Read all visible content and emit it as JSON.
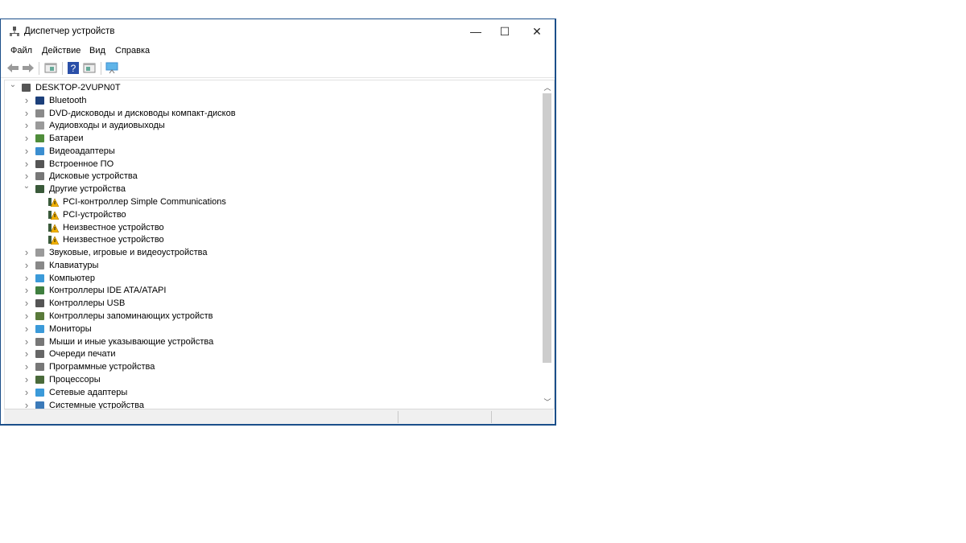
{
  "window": {
    "title": "Диспетчер устройств",
    "minimize": "—",
    "maximize": "☐",
    "close": "✕"
  },
  "menu": [
    "Файл",
    "Действие",
    "Вид",
    "Справка"
  ],
  "toolbar": [
    "back-icon",
    "forward-icon",
    "properties-pane-icon",
    "help-icon",
    "update-driver-icon",
    "monitor-scan-icon"
  ],
  "tree": {
    "root": "DESKTOP-2VUPN0T",
    "items": [
      {
        "label": "Bluetooth",
        "icon": "bluetooth-icon",
        "color": "#1c3f7a",
        "expanded": false
      },
      {
        "label": "DVD-дисководы и дисководы компакт-дисков",
        "icon": "dvd-drive-icon",
        "color": "#8a8a8a",
        "expanded": false
      },
      {
        "label": "Аудиовходы и аудиовыходы",
        "icon": "speaker-icon",
        "color": "#9a9a9a",
        "expanded": false
      },
      {
        "label": "Батареи",
        "icon": "battery-icon",
        "color": "#4f8d3a",
        "expanded": false
      },
      {
        "label": "Видеоадаптеры",
        "icon": "display-adapter-icon",
        "color": "#3b8ed0",
        "expanded": false
      },
      {
        "label": "Встроенное ПО",
        "icon": "firmware-icon",
        "color": "#555555",
        "expanded": false
      },
      {
        "label": "Дисковые устройства",
        "icon": "disk-drive-icon",
        "color": "#777777",
        "expanded": false
      },
      {
        "label": "Другие устройства",
        "icon": "other-devices-icon",
        "color": "#3a5a3a",
        "expanded": true,
        "children": [
          "PCI-контроллер Simple Communications",
          "PCI-устройство",
          "Неизвестное устройство",
          "Неизвестное устройство"
        ]
      },
      {
        "label": "Звуковые, игровые и видеоустройства",
        "icon": "sound-icon",
        "color": "#9a9a9a",
        "expanded": false
      },
      {
        "label": "Клавиатуры",
        "icon": "keyboard-icon",
        "color": "#888888",
        "expanded": false
      },
      {
        "label": "Компьютер",
        "icon": "computer-icon",
        "color": "#3b9ad9",
        "expanded": false
      },
      {
        "label": "Контроллеры IDE ATA/ATAPI",
        "icon": "ide-controller-icon",
        "color": "#3f7f3f",
        "expanded": false
      },
      {
        "label": "Контроллеры USB",
        "icon": "usb-icon",
        "color": "#555555",
        "expanded": false
      },
      {
        "label": "Контроллеры запоминающих устройств",
        "icon": "storage-controller-icon",
        "color": "#5a7a3a",
        "expanded": false
      },
      {
        "label": "Мониторы",
        "icon": "monitor-icon",
        "color": "#3b9ad9",
        "expanded": false
      },
      {
        "label": "Мыши и иные указывающие устройства",
        "icon": "mouse-icon",
        "color": "#777777",
        "expanded": false
      },
      {
        "label": "Очереди печати",
        "icon": "printer-icon",
        "color": "#666666",
        "expanded": false
      },
      {
        "label": "Программные устройства",
        "icon": "software-device-icon",
        "color": "#777777",
        "expanded": false
      },
      {
        "label": "Процессоры",
        "icon": "processor-icon",
        "color": "#4a6a3a",
        "expanded": false
      },
      {
        "label": "Сетевые адаптеры",
        "icon": "network-adapter-icon",
        "color": "#3b9ad9",
        "expanded": false
      },
      {
        "label": "Системные устройства",
        "icon": "system-devices-icon",
        "color": "#3b7ab9",
        "expanded": false
      }
    ]
  },
  "warning_color": "#f2b200"
}
